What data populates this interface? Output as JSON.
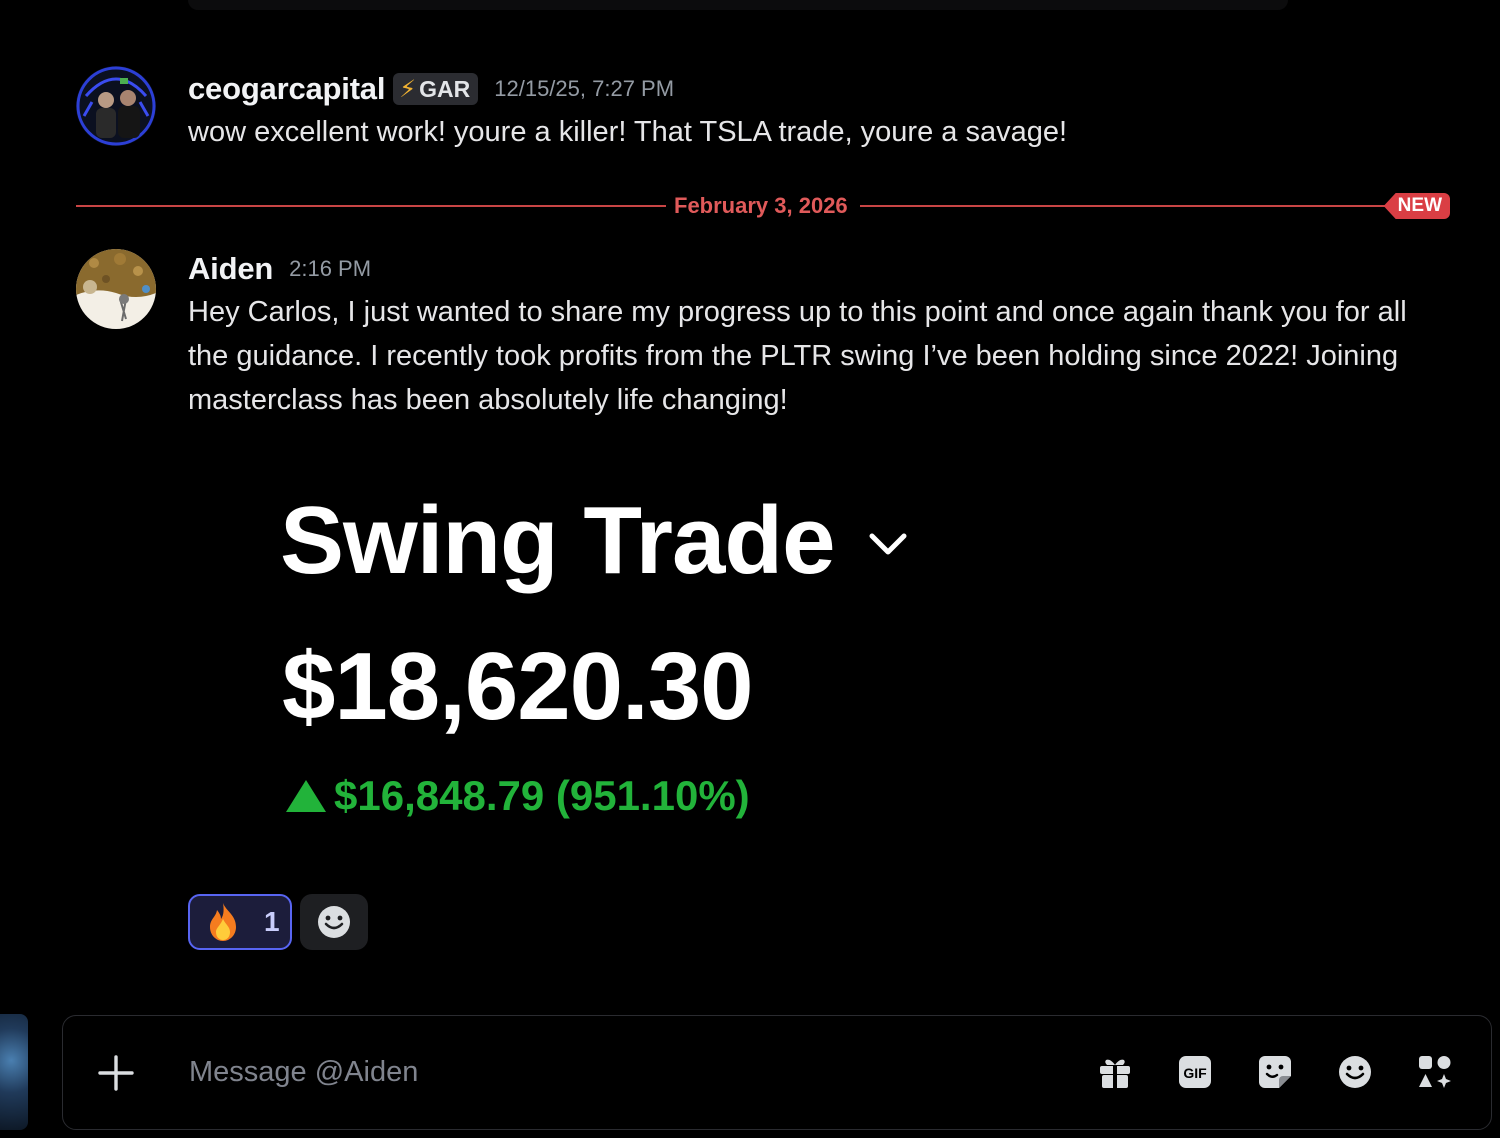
{
  "messages": [
    {
      "username": "ceogarcapital",
      "tag": "GAR",
      "tag_icon": "lightning-bolt",
      "timestamp": "12/15/25, 7:27 PM",
      "text": "wow excellent work! youre a killer! That TSLA trade, youre a savage!"
    },
    {
      "username": "Aiden",
      "timestamp": "2:16 PM",
      "text": "Hey Carlos, I just wanted to share my progress up to this point and once again thank you for all the guidance. I recently took profits from the PLTR swing I’ve been holding since 2022! Joining masterclass has been absolutely life changing!"
    }
  ],
  "divider": {
    "date": "February 3, 2026",
    "badge": "NEW",
    "color": "#da3e44"
  },
  "attachment": {
    "title": "Swing Trade",
    "value": "$18,620.30",
    "change": "$16,848.79 (951.10%)",
    "change_color": "#22b33a"
  },
  "reactions": [
    {
      "emoji": "🔥",
      "count": "1",
      "active": true
    }
  ],
  "composer": {
    "placeholder": "Message @Aiden"
  },
  "icons": {
    "composer_left": "plus-icon",
    "composer_right": [
      "gift-icon",
      "gif-icon",
      "sticker-icon",
      "emoji-icon",
      "apps-icon"
    ],
    "reaction_add": "add-reaction-icon"
  },
  "colors": {
    "background": "#000000",
    "accent": "#5865f2",
    "new_divider": "#da3e44"
  }
}
